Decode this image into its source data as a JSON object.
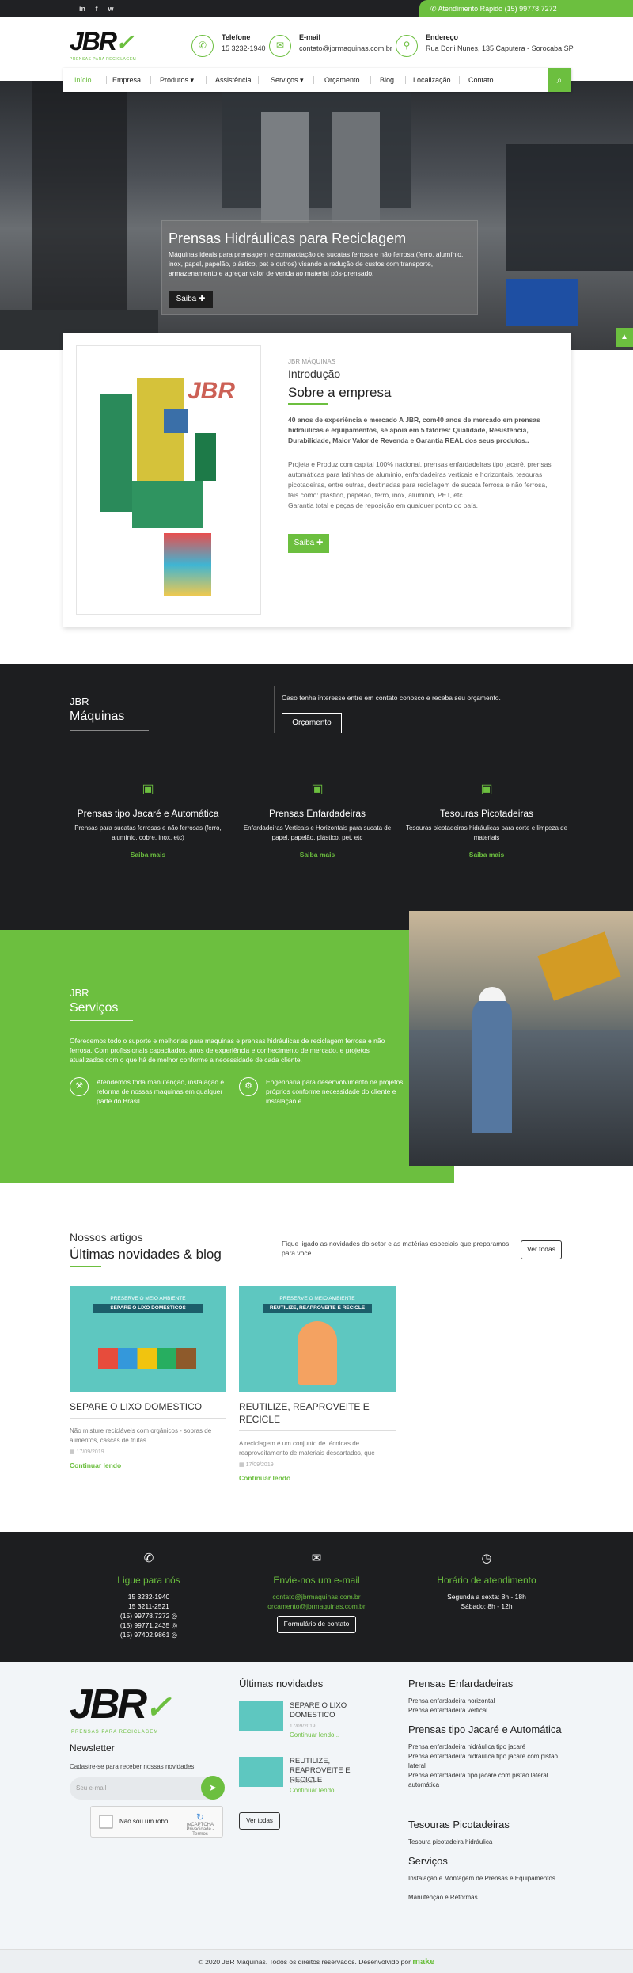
{
  "topbar": {
    "social": [
      "in",
      "f",
      "w"
    ],
    "quick_contact": "Atendimento Rápido (15) 99778.7272"
  },
  "header": {
    "logo": "JBR",
    "logo_tagline": "PRENSAS PARA RECICLAGEM",
    "phone": {
      "title": "Telefone",
      "value": "15 3232-1940"
    },
    "email": {
      "title": "E-mail",
      "value": "contato@jbrmaquinas.com.br"
    },
    "address": {
      "title": "Endereço",
      "value": "Rua Dorli Nunes, 135 Caputera - Sorocaba SP"
    }
  },
  "nav": {
    "items": [
      "Início",
      "Empresa",
      "Produtos",
      "Assistência",
      "Serviços",
      "Orçamento",
      "Blog",
      "Localização",
      "Contato"
    ],
    "active": "Início"
  },
  "hero": {
    "title": "Prensas Hidráulicas para Reciclagem",
    "text": "Máquinas ideais para prensagem e compactação de sucatas ferrosa e não ferrosa (ferro, alumínio, inox, papel, papelão, plástico, pet e outros) visando a redução de custos com transporte, armazenamento e agregar valor de venda ao material pós-prensado.",
    "button": "Saiba"
  },
  "intro": {
    "small": "JBR MÁQUINAS",
    "subtitle": "Introdução",
    "title": "Sobre a empresa",
    "p1": "40 anos de experiência e mercado A JBR, com40 anos de mercado em prensas hidráulicas e equipamentos, se apoia em 5 fatores: Qualidade, Resistência, Durabilidade, Maior Valor de Revenda e Garantia REAL dos seus produtos..",
    "p2": "Projeta e Produz com capital 100% nacional, prensas enfardadeiras tipo jacaré, prensas automáticas para latinhas de alumínio, enfardadeiras verticais e horizontais, tesouras picotadeiras, entre outras, destinadas para reciclagem de sucata ferrosa e não ferrosa, tais como: plástico, papelão, ferro, inox, alumínio, PET, etc.",
    "p3": "Garantia total e peças de reposição em qualquer ponto do país.",
    "button": "Saiba"
  },
  "products_section": {
    "label": "JBR",
    "title": "Máquinas",
    "text": "Caso tenha interesse entre em contato conosco e receba seu orçamento.",
    "button": "Orçamento",
    "items": [
      {
        "title": "Prensas tipo Jacaré e Automática",
        "text": "Prensas para sucatas ferrosas e não ferrosas (ferro, alumínio, cobre, inox, etc)",
        "more": "Saiba mais"
      },
      {
        "title": "Prensas Enfardadeiras",
        "text": "Enfardadeiras Verticais e Horizontais para sucata de papel, papelão, plástico, pet, etc",
        "more": "Saiba mais"
      },
      {
        "title": "Tesouras Picotadeiras",
        "text": "Tesouras picotadeiras hidráulicas para corte e limpeza de materiais",
        "more": "Saiba mais"
      }
    ]
  },
  "services": {
    "label": "JBR",
    "title": "Serviços",
    "text": "Oferecemos todo o suporte e melhorias para maquinas e prensas hidráulicas de reciclagem ferrosa e não ferrosa. Com profissionais capacitados, anos de experiência e conhecimento de mercado, e projetos atualizados com o que há de melhor conforme a necessidade de cada cliente.",
    "items": [
      "Atendemos toda manutenção, instalação e reforma de nossas maquinas em qualquer parte do Brasil.",
      "Engenharia para desenvolvimento de projetos próprios conforme necessidade do cliente e instalação e"
    ]
  },
  "blog": {
    "small": "Nossos artigos",
    "title": "Últimas novidades & blog",
    "desc": "Fique ligado as novidades do setor e as matérias especiais que preparamos para você.",
    "button": "Ver todas",
    "posts": [
      {
        "tag": "PRESERVE O MEIO AMBIENTE",
        "band": "SEPARE O LIXO DOMÉSTICOS",
        "title": "SEPARE O LIXO DOMESTICO",
        "text": "Não misture recicláveis com orgânicos - sobras de alimentos, cascas de frutas",
        "date": "17/09/2019",
        "more": "Continuar lendo"
      },
      {
        "tag": "PRESERVE O MEIO AMBIENTE",
        "band": "REUTILIZE, REAPROVEITE E RECICLE",
        "title": "REUTILIZE, REAPROVEITE E RECICLE",
        "text": "A reciclagem é um conjunto de técnicas de reaproveitamento de materiais descartados, que",
        "date": "17/09/2019",
        "more": "Continuar lendo"
      }
    ]
  },
  "contact": {
    "phone": {
      "title": "Ligue para nós",
      "lines": [
        "15 3232-1940",
        "15 3211-2521",
        "(15) 99778.7272",
        "(15) 99771.2435",
        "(15) 97402.9861"
      ]
    },
    "email": {
      "title": "Envie-nos um e-mail",
      "lines": [
        "contato@jbrmaquinas.com.br",
        "orcamento@jbrmaquinas.com.br"
      ],
      "button": "Formulário de contato"
    },
    "hours": {
      "title": "Horário de atendimento",
      "lines": [
        "Segunda a sexta: 8h - 18h",
        "Sábado: 8h - 12h"
      ]
    }
  },
  "footer": {
    "newsletter_title": "Newsletter",
    "newsletter_text": "Cadastre-se para receber nossas novidades.",
    "email_placeholder": "Seu e-mail",
    "captcha_label": "Não sou um robô",
    "captcha_brand": "reCAPTCHA",
    "captcha_links": "Privacidade - Termos",
    "news_title": "Últimas novidades",
    "news": [
      {
        "title": "SEPARE O LIXO DOMESTICO",
        "date": "17/09/2019",
        "more": "Continuar lendo..."
      },
      {
        "title": "REUTILIZE, REAPROVEITE E RECICLE",
        "date": "17/09/2019",
        "more": "Continuar lendo..."
      }
    ],
    "news_button": "Ver todas",
    "col3": [
      {
        "title": "Prensas Enfardadeiras",
        "links": [
          "Prensa enfardadeira horizontal",
          "Prensa enfardadeira vertical"
        ]
      },
      {
        "title": "Prensas tipo Jacaré e Automática",
        "links": [
          "Prensa enfardadeira hidráulica tipo jacaré",
          "Prensa enfardadeira hidráulica tipo jacaré com pistão lateral",
          "Prensa enfardadeira tipo jacaré com pistão lateral automática"
        ]
      },
      {
        "title": "Tesouras Picotadeiras",
        "links": [
          "Tesoura picotadeira hidráulica"
        ]
      },
      {
        "title": "Serviços",
        "links": [
          "Instalação e Montagem de Prensas e Equipamentos",
          "Manutenção e Reformas"
        ]
      }
    ]
  },
  "bottom": {
    "copyright": "© 2020 JBR Máquinas. Todos os direitos reservados. Desenvolvido por",
    "dev": "make"
  },
  "colors": {
    "accent": "#6cbf3f",
    "dark": "#1d1e20"
  }
}
